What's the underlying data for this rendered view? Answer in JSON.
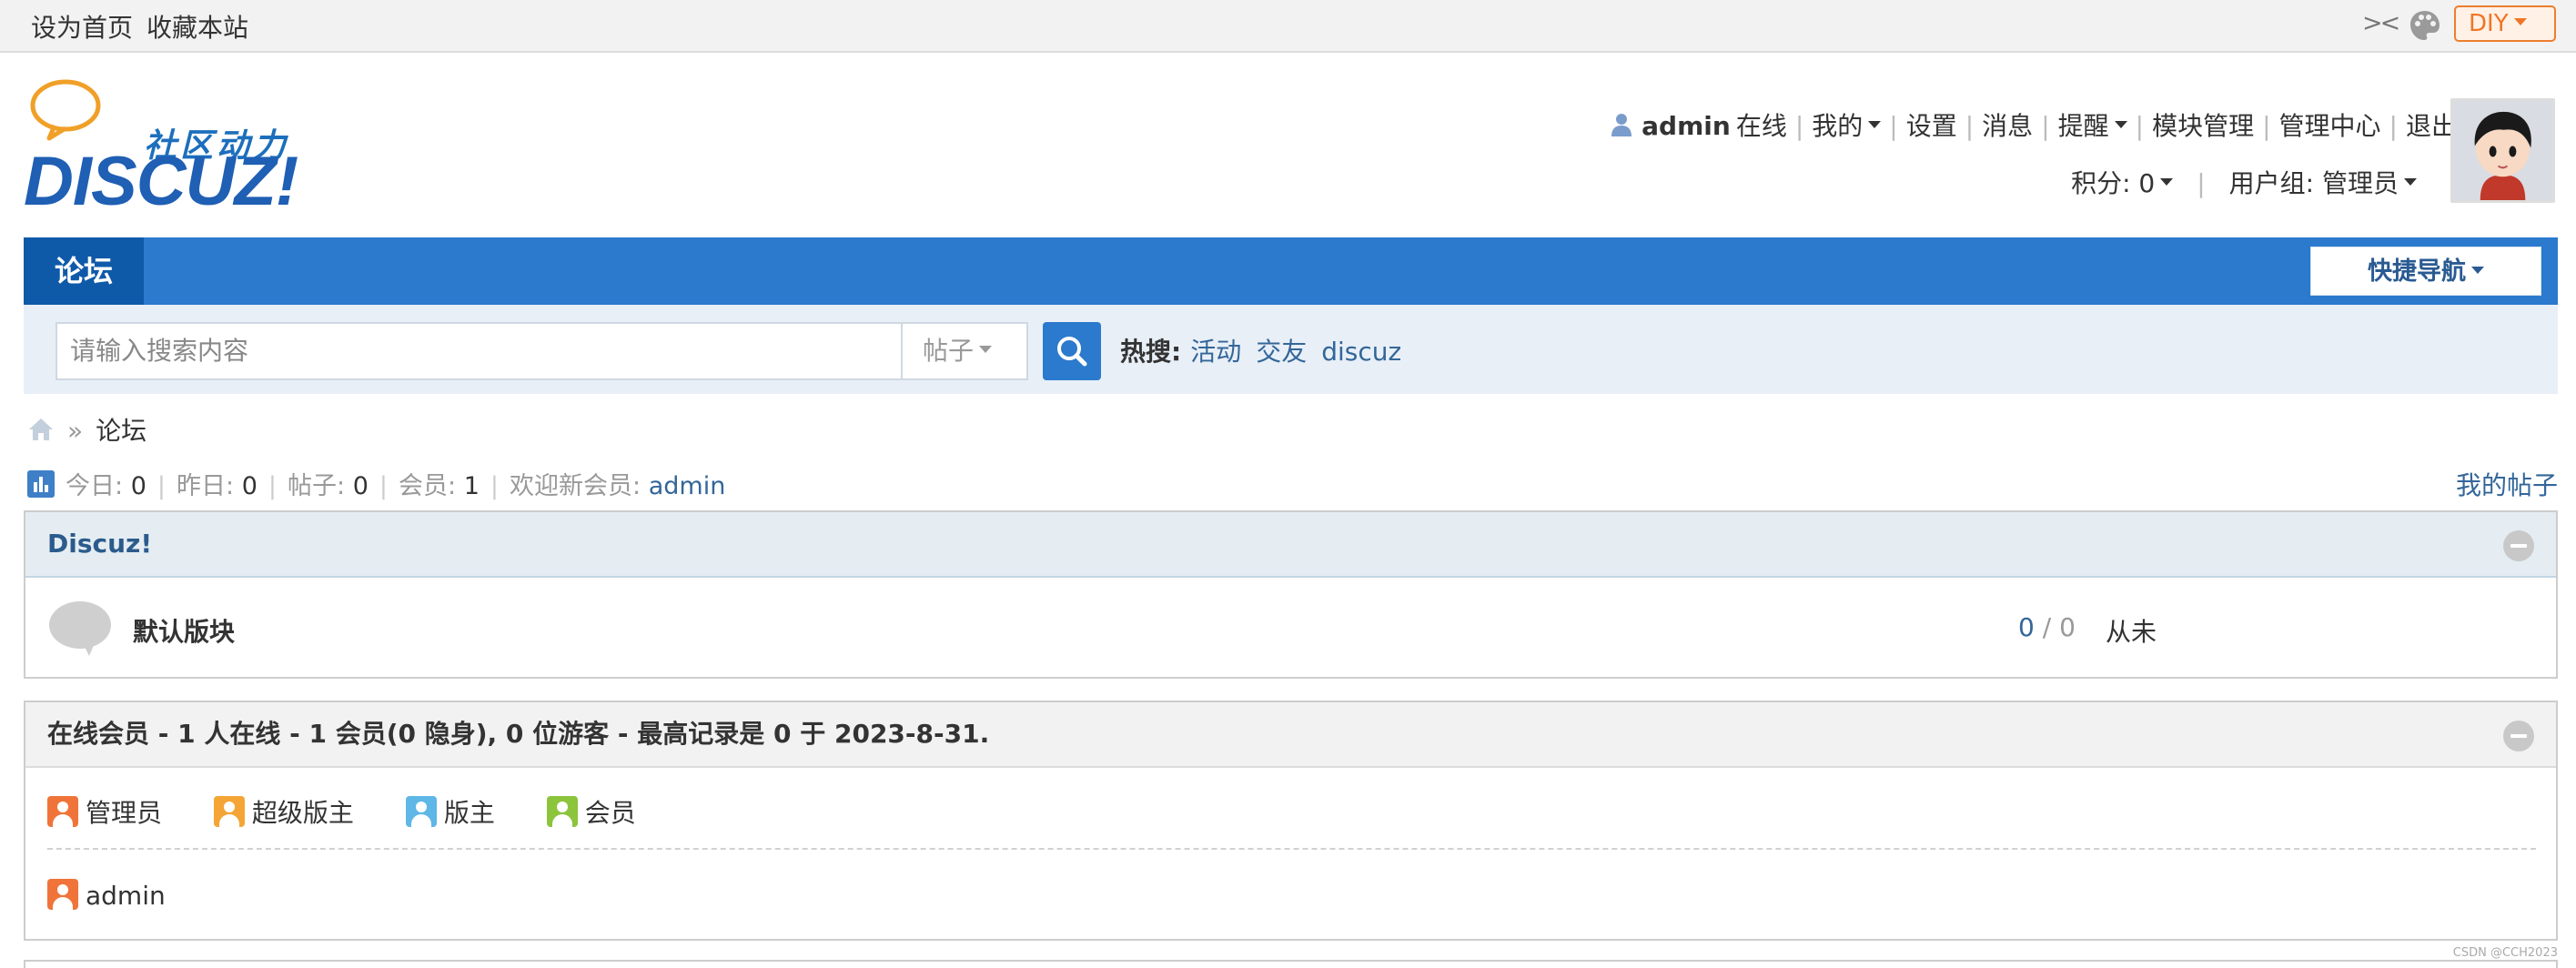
{
  "topbar": {
    "set_home": "设为首页",
    "bookmark": "收藏本站",
    "collapse_glyph": "><",
    "diy_label": "DIY"
  },
  "logo": {
    "tagline": "社区动力",
    "wordmark": "DISCUZ!"
  },
  "user_nav": {
    "username": "admin",
    "status": "在线",
    "items": [
      "我的",
      "设置",
      "消息",
      "提醒",
      "模块管理",
      "管理中心",
      "退出"
    ]
  },
  "user_meta": {
    "credits": "积分: 0",
    "group": "用户组: 管理员"
  },
  "nav": {
    "active_tab": "论坛",
    "quick_nav": "快捷导航"
  },
  "search": {
    "placeholder": "请输入搜索内容",
    "type": "帖子",
    "hot_label": "热搜:",
    "hot_keywords": [
      "活动",
      "交友",
      "discuz"
    ]
  },
  "breadcrumb": {
    "current": "论坛"
  },
  "stats": {
    "today_label": "今日:",
    "today": "0",
    "yesterday_label": "昨日:",
    "yesterday": "0",
    "posts_label": "帖子:",
    "posts": "0",
    "members_label": "会员:",
    "members": "1",
    "welcome_label": "欢迎新会员:",
    "newest_member": "admin",
    "my_posts": "我的帖子"
  },
  "category": {
    "title": "Discuz!",
    "forums": [
      {
        "name": "默认版块",
        "threads": "0",
        "slash": "/",
        "posts": "0",
        "last_post": "从未"
      }
    ]
  },
  "online": {
    "title": "在线会员 - 1 人在线 - 1 会员(0 隐身), 0 位游客 - 最高记录是 0 于 2023-8-31.",
    "legend": [
      {
        "label": "管理员",
        "color": "#f0743a"
      },
      {
        "label": "超级版主",
        "color": "#f4a536"
      },
      {
        "label": "版主",
        "color": "#5eb7e6"
      },
      {
        "label": "会员",
        "color": "#8cc43c"
      }
    ],
    "users": [
      {
        "name": "admin",
        "color": "#f0743a"
      }
    ]
  },
  "watermark": "CSDN @CCH2023",
  "colors": {
    "nav_blue": "#2b7acd",
    "nav_active": "#0f5aa8",
    "link": "#336699",
    "diy_orange": "#f07526"
  }
}
